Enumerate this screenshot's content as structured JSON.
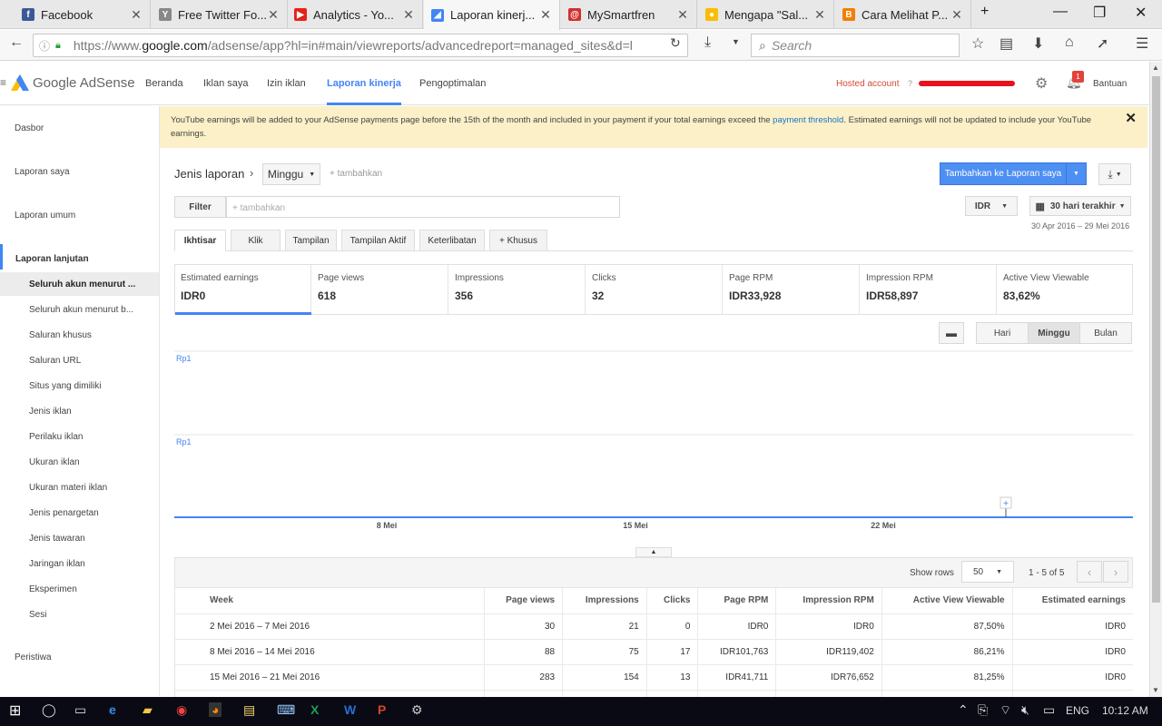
{
  "browser": {
    "tabs": [
      {
        "title": "Facebook",
        "icon": "facebook-icon",
        "color": "#3b5998",
        "glyph": "f"
      },
      {
        "title": "Free Twitter Fo...",
        "icon": "yahoo-icon",
        "color": "#888",
        "glyph": "Y"
      },
      {
        "title": "Analytics - Yo...",
        "icon": "youtube-icon",
        "color": "#e62117",
        "glyph": "▶"
      },
      {
        "title": "Laporan kinerj...",
        "icon": "adsense-icon",
        "color": "#4285f4",
        "glyph": "◢"
      },
      {
        "title": "MySmartfren",
        "icon": "smartfren-icon",
        "color": "#d32f2f",
        "glyph": "@"
      },
      {
        "title": "Mengapa \"Sal...",
        "icon": "google-icon",
        "color": "#fbbc05",
        "glyph": "●"
      },
      {
        "title": "Cara Melihat P...",
        "icon": "blogger-icon",
        "color": "#f57d00",
        "glyph": "B"
      }
    ],
    "url_prefix": "https://www.",
    "url_domain": "google.com",
    "url_rest": "/adsense/app?hl=in#main/viewreports/advancedreport=managed_sites&d=l",
    "search_placeholder": "Search"
  },
  "header": {
    "logo": "Google AdSense",
    "nav": [
      "Beranda",
      "Iklan saya",
      "Izin iklan",
      "Laporan kinerja",
      "Pengoptimalan"
    ],
    "hosted": "Hosted account",
    "notif_count": "1",
    "help": "Bantuan"
  },
  "sidebar": {
    "top": [
      "Dasbor",
      "Laporan saya",
      "Laporan umum"
    ],
    "section": "Laporan lanjutan",
    "sub": [
      "Seluruh akun menurut ...",
      "Seluruh akun menurut b...",
      "Saluran khusus",
      "Saluran URL",
      "Situs yang dimiliki",
      "Jenis iklan",
      "Perilaku iklan",
      "Ukuran iklan",
      "Ukuran materi iklan",
      "Jenis penargetan",
      "Jenis tawaran",
      "Jaringan iklan",
      "Eksperimen",
      "Sesi"
    ],
    "bottom": "Peristiwa"
  },
  "banner": {
    "text1": "YouTube earnings will be added to your AdSense payments page before the 15th of the month and included in your payment if your total earnings exceed the ",
    "link": "payment threshold",
    "text2": ". Estimated earnings will not be updated to include your YouTube earnings."
  },
  "report": {
    "type_label": "Jenis laporan",
    "period": "Minggu",
    "add_dim": "+ tambahkan",
    "add_to_reports": "Tambahkan ke Laporan saya",
    "filter": "Filter",
    "filter_placeholder": "+ tambahkan",
    "currency": "IDR",
    "range": "30 hari terakhir",
    "range_dates": "30 Apr 2016 – 29 Mei 2016",
    "tabs": [
      "Ikhtisar",
      "Klik",
      "Tampilan",
      "Tampilan Aktif",
      "Keterlibatan",
      "+ Khusus"
    ],
    "granularity": [
      "Hari",
      "Minggu",
      "Bulan"
    ]
  },
  "metrics": [
    {
      "label": "Estimated earnings",
      "value": "IDR0"
    },
    {
      "label": "Page views",
      "value": "618"
    },
    {
      "label": "Impressions",
      "value": "356"
    },
    {
      "label": "Clicks",
      "value": "32"
    },
    {
      "label": "Page RPM",
      "value": "IDR33,928"
    },
    {
      "label": "Impression RPM",
      "value": "IDR58,897"
    },
    {
      "label": "Active View Viewable",
      "value": "83,62%"
    }
  ],
  "chart_data": {
    "type": "line",
    "categories": [
      "8 Mei",
      "15 Mei",
      "22 Mei"
    ],
    "series": [
      {
        "values": [
          0,
          0,
          0,
          0,
          0
        ]
      }
    ],
    "y_ticks": [
      "Rp1",
      "Rp1"
    ],
    "ylim": [
      0,
      1
    ]
  },
  "table": {
    "show_rows_label": "Show rows",
    "rows_value": "50",
    "pager": "1 - 5 of 5",
    "headers": [
      "Week",
      "Page views",
      "Impressions",
      "Clicks",
      "Page RPM",
      "Impression RPM",
      "Active View Viewable",
      "Estimated earnings"
    ],
    "rows": [
      [
        "2 Mei 2016 – 7 Mei 2016",
        "30",
        "21",
        "0",
        "IDR0",
        "IDR0",
        "87,50%",
        "IDR0"
      ],
      [
        "8 Mei 2016 – 14 Mei 2016",
        "88",
        "75",
        "17",
        "IDR101,763",
        "IDR119,402",
        "86,21%",
        "IDR0"
      ],
      [
        "15 Mei 2016 – 21 Mei 2016",
        "283",
        "154",
        "13",
        "IDR41,711",
        "IDR76,652",
        "81,25%",
        "IDR0"
      ]
    ]
  },
  "taskbar": {
    "lang": "ENG",
    "time": "10:12 AM"
  }
}
